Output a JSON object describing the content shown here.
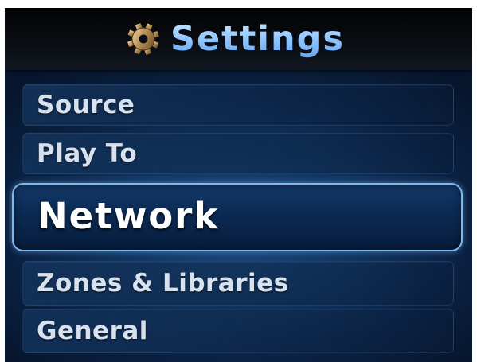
{
  "header": {
    "title": "Settings",
    "icon": "gear-icon"
  },
  "menu": {
    "items": [
      {
        "label": "Source"
      },
      {
        "label": "Play To"
      },
      {
        "label": "Network",
        "selected": true
      },
      {
        "label": "Zones & Libraries"
      },
      {
        "label": "General"
      }
    ]
  },
  "colors": {
    "title": "#8ec4ff",
    "selection_border": "#7fb6ec",
    "background": "#123763"
  }
}
